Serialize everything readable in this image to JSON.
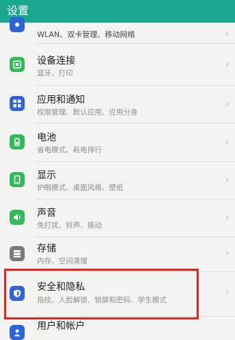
{
  "header": {
    "title": "设置"
  },
  "items": [
    {
      "label": "",
      "sub": "WLAN、双卡管理、移动网络",
      "icon": "network-icon",
      "color": "#2f63d6"
    },
    {
      "label": "设备连接",
      "sub": "蓝牙、打印",
      "icon": "device-connect-icon",
      "color": "#33b85c"
    },
    {
      "label": "应用和通知",
      "sub": "权限管理、默认应用、应用分身",
      "icon": "apps-icon",
      "color": "#2f63d6"
    },
    {
      "label": "电池",
      "sub": "省电模式、耗电排行",
      "icon": "battery-icon",
      "color": "#33b85c"
    },
    {
      "label": "显示",
      "sub": "护眼模式、桌面风格、壁纸",
      "icon": "display-icon",
      "color": "#33b85c"
    },
    {
      "label": "声音",
      "sub": "免打扰、铃声、振动",
      "icon": "sound-icon",
      "color": "#33b85c"
    },
    {
      "label": "存储",
      "sub": "内存、空间清理",
      "icon": "storage-icon",
      "color": "#7a7a7a"
    },
    {
      "label": "安全和隐私",
      "sub": "指纹、人脸解锁、锁屏和密码、学生模式",
      "icon": "security-shield-icon",
      "color": "#2f63d6"
    },
    {
      "label": "用户和帐户",
      "sub": "",
      "icon": "user-icon",
      "color": "#2f63d6"
    }
  ],
  "chevron": "›",
  "highlight_color": "#e2241e"
}
